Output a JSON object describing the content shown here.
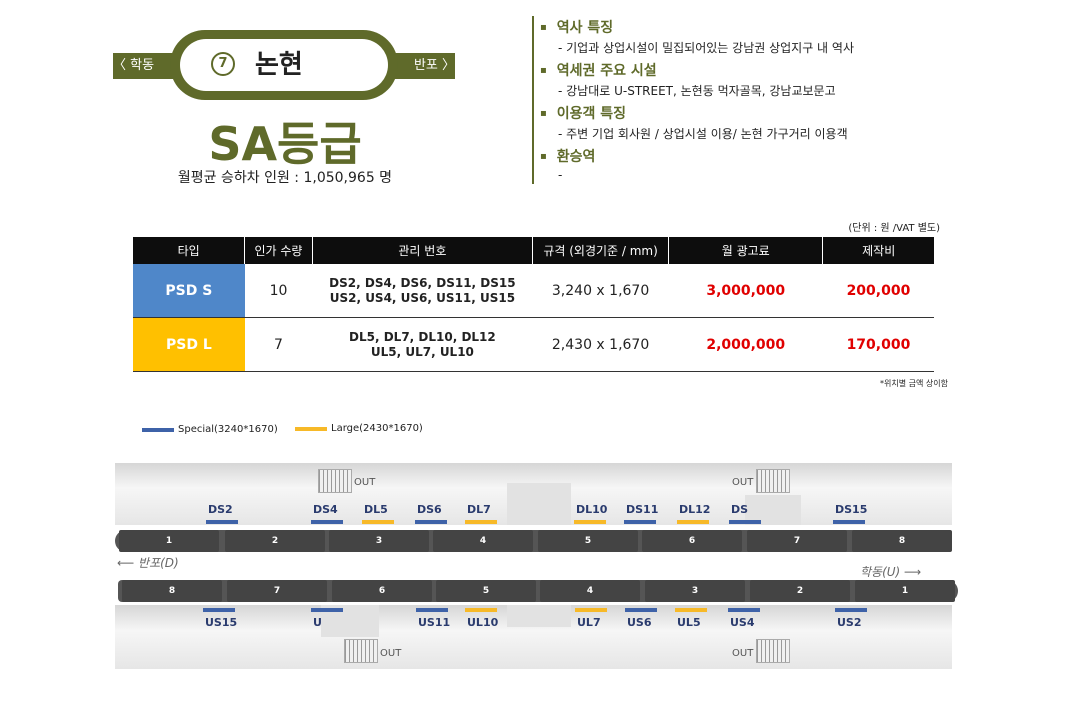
{
  "station": {
    "number": "7",
    "name": "논현",
    "prev": "〈 학동",
    "next": "반포 〉",
    "grade": "SA등급",
    "ridership": "월평균 승하차 인원 : 1,050,965 명"
  },
  "colors": {
    "brand": "#5f6a2a",
    "special": "#3e62a8",
    "large": "#f7b928",
    "price_red": "#e00000"
  },
  "features": [
    {
      "title": "역사 특징",
      "desc": "- 기업과 상업시설이 밀집되어있는 강남권 상업지구 내 역사"
    },
    {
      "title": "역세권 주요 시설",
      "desc": "- 강남대로 U-STREET, 논현동 먹자골목,  강남교보문고"
    },
    {
      "title": "이용객 특징",
      "desc": "- 주변 기업 회사원 / 상업시설 이용/ 논현 가구거리 이용객"
    },
    {
      "title": "환승역",
      "desc": "-"
    }
  ],
  "table": {
    "unit_note": "(단위 : 원 /VAT 별도)",
    "headers": [
      "타입",
      "인가 수량",
      "관리 번호",
      "규격 (외경기준 / mm)",
      "월 광고료",
      "제작비"
    ],
    "rows": [
      {
        "type": "PSD S",
        "qty": "10",
        "codes1": "DS2, DS4, DS6, DS11, DS15",
        "codes2": "US2, US4, US6, US11, US15",
        "size": "3,240 x 1,670",
        "monthly": "3,000,000",
        "production": "200,000"
      },
      {
        "type": "PSD L",
        "qty": "7",
        "codes1": "DL5, DL7, DL10, DL12",
        "codes2": "UL5, UL7, UL10",
        "size": "2,430 x 1,670",
        "monthly": "2,000,000",
        "production": "170,000"
      }
    ],
    "price_note": "*위치별 금액 상이함"
  },
  "legend": {
    "special": "Special(3240*1670)",
    "large": "Large(2430*1670)"
  },
  "diagram": {
    "upper_cars": [
      "1",
      "2",
      "3",
      "4",
      "5",
      "6",
      "7",
      "8"
    ],
    "lower_cars": [
      "8",
      "7",
      "6",
      "5",
      "4",
      "3",
      "2",
      "1"
    ],
    "upper_labels": [
      "DS2",
      "DS4",
      "DL5",
      "DS6",
      "DL7",
      "DL10",
      "DS11",
      "DL12",
      "DS",
      "DS15"
    ],
    "lower_labels": [
      "US15",
      "U",
      "US11",
      "UL10",
      "UL7",
      "US6",
      "UL5",
      "US4",
      "US2"
    ],
    "exit": "OUT",
    "dir_left": "반포(D)",
    "dir_right": "학동(U)"
  }
}
